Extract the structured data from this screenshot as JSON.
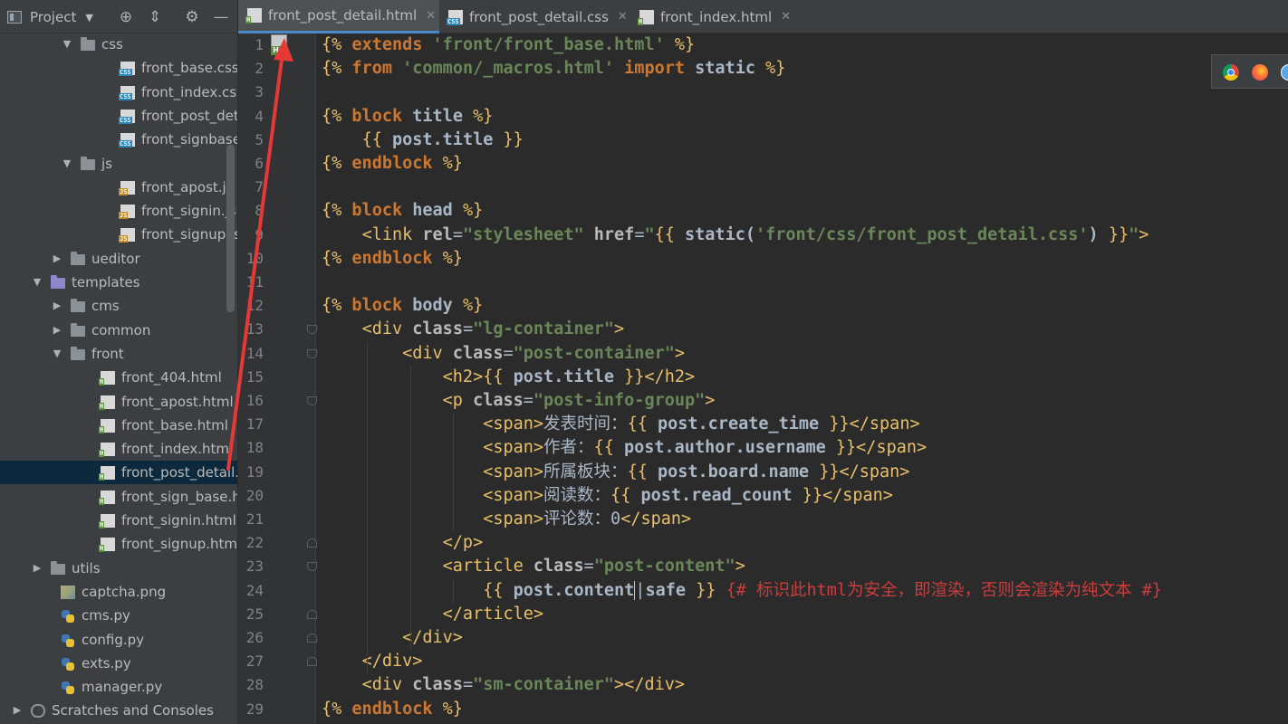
{
  "project_header": {
    "title": "Project",
    "buttons": [
      "target-icon",
      "collapse-icon",
      "gear-icon",
      "minimize-icon"
    ]
  },
  "tree": [
    {
      "label": "css",
      "kind": "folder",
      "expanded": true,
      "indent": 1
    },
    {
      "label": "front_base.css",
      "kind": "css",
      "indent": 3
    },
    {
      "label": "front_index.css",
      "kind": "css",
      "indent": 3
    },
    {
      "label": "front_post_detail",
      "kind": "css",
      "indent": 3
    },
    {
      "label": "front_signbase.cs",
      "kind": "css",
      "indent": 3
    },
    {
      "label": "js",
      "kind": "folder",
      "expanded": true,
      "indent": 1
    },
    {
      "label": "front_apost.js",
      "kind": "js",
      "indent": 3
    },
    {
      "label": "front_signin.js",
      "kind": "js",
      "indent": 3
    },
    {
      "label": "front_signup.js",
      "kind": "js",
      "indent": 3
    },
    {
      "label": "ueditor",
      "kind": "folder",
      "expanded": false,
      "indent": 0.5
    },
    {
      "label": "templates",
      "kind": "folder-violet",
      "expanded": true,
      "indent": -0.5
    },
    {
      "label": "cms",
      "kind": "folder",
      "expanded": false,
      "indent": 0.5
    },
    {
      "label": "common",
      "kind": "folder",
      "expanded": false,
      "indent": 0.5
    },
    {
      "label": "front",
      "kind": "folder",
      "expanded": true,
      "indent": 0.5
    },
    {
      "label": "front_404.html",
      "kind": "html",
      "indent": 2
    },
    {
      "label": "front_apost.html",
      "kind": "html",
      "indent": 2
    },
    {
      "label": "front_base.html",
      "kind": "html",
      "indent": 2
    },
    {
      "label": "front_index.html",
      "kind": "html",
      "indent": 2
    },
    {
      "label": "front_post_detail.htm",
      "kind": "html",
      "indent": 2,
      "selected": true
    },
    {
      "label": "front_sign_base.html",
      "kind": "html",
      "indent": 2
    },
    {
      "label": "front_signin.html",
      "kind": "html",
      "indent": 2
    },
    {
      "label": "front_signup.html",
      "kind": "html",
      "indent": 2
    },
    {
      "label": "utils",
      "kind": "folder",
      "expanded": false,
      "indent": -0.5
    },
    {
      "label": "captcha.png",
      "kind": "png",
      "indent": 0
    },
    {
      "label": "cms.py",
      "kind": "py",
      "indent": 0
    },
    {
      "label": "config.py",
      "kind": "py",
      "indent": 0
    },
    {
      "label": "exts.py",
      "kind": "py",
      "indent": 0
    },
    {
      "label": "manager.py",
      "kind": "py",
      "indent": 0
    },
    {
      "label": "Scratches and Consoles",
      "kind": "scratch",
      "expanded": false,
      "indent": -1.5
    }
  ],
  "tabs": [
    {
      "label": "front_post_detail.html",
      "kind": "html",
      "active": true
    },
    {
      "label": "front_post_detail.css",
      "kind": "css",
      "active": false
    },
    {
      "label": "front_index.html",
      "kind": "html",
      "active": false
    }
  ],
  "editor": {
    "lines": [
      {
        "n": "1",
        "tokens": [
          [
            "delim",
            "{% "
          ],
          [
            "kw",
            "extends"
          ],
          [
            "txt",
            " "
          ],
          [
            "str",
            "'front/front_base.html'"
          ],
          [
            "delim",
            " %}"
          ]
        ]
      },
      {
        "n": "2",
        "tokens": [
          [
            "delim",
            "{% "
          ],
          [
            "kw",
            "from"
          ],
          [
            "txt",
            " "
          ],
          [
            "str",
            "'common/_macros.html'"
          ],
          [
            "txt",
            " "
          ],
          [
            "kw",
            "import"
          ],
          [
            "txt",
            " "
          ],
          [
            "var",
            "static"
          ],
          [
            "delim",
            " %}"
          ]
        ]
      },
      {
        "n": "3",
        "tokens": []
      },
      {
        "n": "4",
        "tokens": [
          [
            "delim",
            "{% "
          ],
          [
            "kw",
            "block"
          ],
          [
            "txt",
            " "
          ],
          [
            "var",
            "title"
          ],
          [
            "delim",
            " %}"
          ]
        ]
      },
      {
        "n": "5",
        "tokens": [
          [
            "txt",
            "    "
          ],
          [
            "delim",
            "{{ "
          ],
          [
            "var",
            "post.title"
          ],
          [
            "delim",
            " }}"
          ]
        ]
      },
      {
        "n": "6",
        "tokens": [
          [
            "delim",
            "{% "
          ],
          [
            "kw",
            "endblock"
          ],
          [
            "delim",
            " %}"
          ]
        ]
      },
      {
        "n": "7",
        "tokens": []
      },
      {
        "n": "8",
        "tokens": [
          [
            "delim",
            "{% "
          ],
          [
            "kw",
            "block"
          ],
          [
            "txt",
            " "
          ],
          [
            "var",
            "head"
          ],
          [
            "delim",
            " %}"
          ]
        ]
      },
      {
        "n": "9",
        "tokens": [
          [
            "txt",
            "    "
          ],
          [
            "tag",
            "<link "
          ],
          [
            "attr",
            "rel"
          ],
          [
            "txt",
            "="
          ],
          [
            "val",
            "\"stylesheet\""
          ],
          [
            "txt",
            " "
          ],
          [
            "attr",
            "href"
          ],
          [
            "txt",
            "="
          ],
          [
            "val",
            "\""
          ],
          [
            "delim",
            "{{ "
          ],
          [
            "var",
            "static("
          ],
          [
            "str",
            "'front/css/front_post_detail.css'"
          ],
          [
            "var",
            ")"
          ],
          [
            "delim",
            " }}"
          ],
          [
            "val",
            "\""
          ],
          [
            "tag",
            ">"
          ]
        ]
      },
      {
        "n": "10",
        "tokens": [
          [
            "delim",
            "{% "
          ],
          [
            "kw",
            "endblock"
          ],
          [
            "delim",
            " %}"
          ]
        ]
      },
      {
        "n": "11",
        "tokens": []
      },
      {
        "n": "12",
        "tokens": [
          [
            "delim",
            "{% "
          ],
          [
            "kw",
            "block"
          ],
          [
            "txt",
            " "
          ],
          [
            "var",
            "body"
          ],
          [
            "delim",
            " %}"
          ]
        ]
      },
      {
        "n": "13",
        "tokens": [
          [
            "txt",
            "    "
          ],
          [
            "tag",
            "<div "
          ],
          [
            "attr",
            "class"
          ],
          [
            "txt",
            "="
          ],
          [
            "val",
            "\"lg-container\""
          ],
          [
            "tag",
            ">"
          ]
        ]
      },
      {
        "n": "14",
        "tokens": [
          [
            "txt",
            "        "
          ],
          [
            "tag",
            "<div "
          ],
          [
            "attr",
            "class"
          ],
          [
            "txt",
            "="
          ],
          [
            "val",
            "\"post-container\""
          ],
          [
            "tag",
            ">"
          ]
        ]
      },
      {
        "n": "15",
        "tokens": [
          [
            "txt",
            "            "
          ],
          [
            "tag",
            "<h2>"
          ],
          [
            "delim",
            "{{ "
          ],
          [
            "var",
            "post.title"
          ],
          [
            "delim",
            " }}"
          ],
          [
            "tag",
            "</h2>"
          ]
        ]
      },
      {
        "n": "16",
        "tokens": [
          [
            "txt",
            "            "
          ],
          [
            "tag",
            "<p "
          ],
          [
            "attr",
            "class"
          ],
          [
            "txt",
            "="
          ],
          [
            "val",
            "\"post-info-group\""
          ],
          [
            "tag",
            ">"
          ]
        ]
      },
      {
        "n": "17",
        "tokens": [
          [
            "txt",
            "                "
          ],
          [
            "tag",
            "<span>"
          ],
          [
            "cn",
            "发表时间："
          ],
          [
            "delim",
            "{{ "
          ],
          [
            "var",
            "post.create_time"
          ],
          [
            "delim",
            " }}"
          ],
          [
            "tag",
            "</span>"
          ]
        ]
      },
      {
        "n": "18",
        "tokens": [
          [
            "txt",
            "                "
          ],
          [
            "tag",
            "<span>"
          ],
          [
            "cn",
            "作者："
          ],
          [
            "delim",
            "{{ "
          ],
          [
            "var",
            "post.author.username"
          ],
          [
            "delim",
            " }}"
          ],
          [
            "tag",
            "</span>"
          ]
        ]
      },
      {
        "n": "19",
        "tokens": [
          [
            "txt",
            "                "
          ],
          [
            "tag",
            "<span>"
          ],
          [
            "cn",
            "所属板块："
          ],
          [
            "delim",
            "{{ "
          ],
          [
            "var",
            "post.board.name"
          ],
          [
            "delim",
            " }}"
          ],
          [
            "tag",
            "</span>"
          ]
        ]
      },
      {
        "n": "20",
        "tokens": [
          [
            "txt",
            "                "
          ],
          [
            "tag",
            "<span>"
          ],
          [
            "cn",
            "阅读数："
          ],
          [
            "delim",
            "{{ "
          ],
          [
            "var",
            "post.read_count"
          ],
          [
            "delim",
            " }}"
          ],
          [
            "tag",
            "</span>"
          ]
        ]
      },
      {
        "n": "21",
        "tokens": [
          [
            "txt",
            "                "
          ],
          [
            "tag",
            "<span>"
          ],
          [
            "cn",
            "评论数：0"
          ],
          [
            "tag",
            "</span>"
          ]
        ]
      },
      {
        "n": "22",
        "tokens": [
          [
            "txt",
            "            "
          ],
          [
            "tag",
            "</p>"
          ]
        ]
      },
      {
        "n": "23",
        "tokens": [
          [
            "txt",
            "            "
          ],
          [
            "tag",
            "<article "
          ],
          [
            "attr",
            "class"
          ],
          [
            "txt",
            "="
          ],
          [
            "val",
            "\"post-content\""
          ],
          [
            "tag",
            ">"
          ]
        ]
      },
      {
        "n": "24",
        "tokens": [
          [
            "txt",
            "                "
          ],
          [
            "delim",
            "{{ "
          ],
          [
            "var",
            "post.content"
          ],
          [
            "pipe",
            "|"
          ],
          [
            "var",
            "safe"
          ],
          [
            "delim",
            " }}"
          ],
          [
            "txt",
            " "
          ],
          [
            "cmt",
            "{# 标识此html为安全，即渲染，否则会渲染为纯文本 #}"
          ]
        ]
      },
      {
        "n": "25",
        "tokens": [
          [
            "txt",
            "            "
          ],
          [
            "tag",
            "</article>"
          ]
        ]
      },
      {
        "n": "26",
        "tokens": [
          [
            "txt",
            "        "
          ],
          [
            "tag",
            "</div>"
          ]
        ]
      },
      {
        "n": "27",
        "tokens": [
          [
            "txt",
            "    "
          ],
          [
            "tag",
            "</div>"
          ]
        ]
      },
      {
        "n": "28",
        "tokens": [
          [
            "txt",
            "    "
          ],
          [
            "tag",
            "<div "
          ],
          [
            "attr",
            "class"
          ],
          [
            "txt",
            "="
          ],
          [
            "val",
            "\"sm-container\""
          ],
          [
            "tag",
            "></div>"
          ]
        ]
      },
      {
        "n": "29",
        "tokens": [
          [
            "delim",
            "{% "
          ],
          [
            "kw",
            "endblock"
          ],
          [
            "delim",
            " %}"
          ]
        ]
      }
    ]
  },
  "browser_icons": [
    "chrome-icon",
    "firefox-icon",
    "safari-icon"
  ],
  "colors": {
    "keyword": "#cc7832",
    "string": "#6a8759",
    "delimiter": "#e8bf6a",
    "comment": "#cc3d3d",
    "selection": "#0d293e",
    "annotation_arrow": "#e53935"
  }
}
